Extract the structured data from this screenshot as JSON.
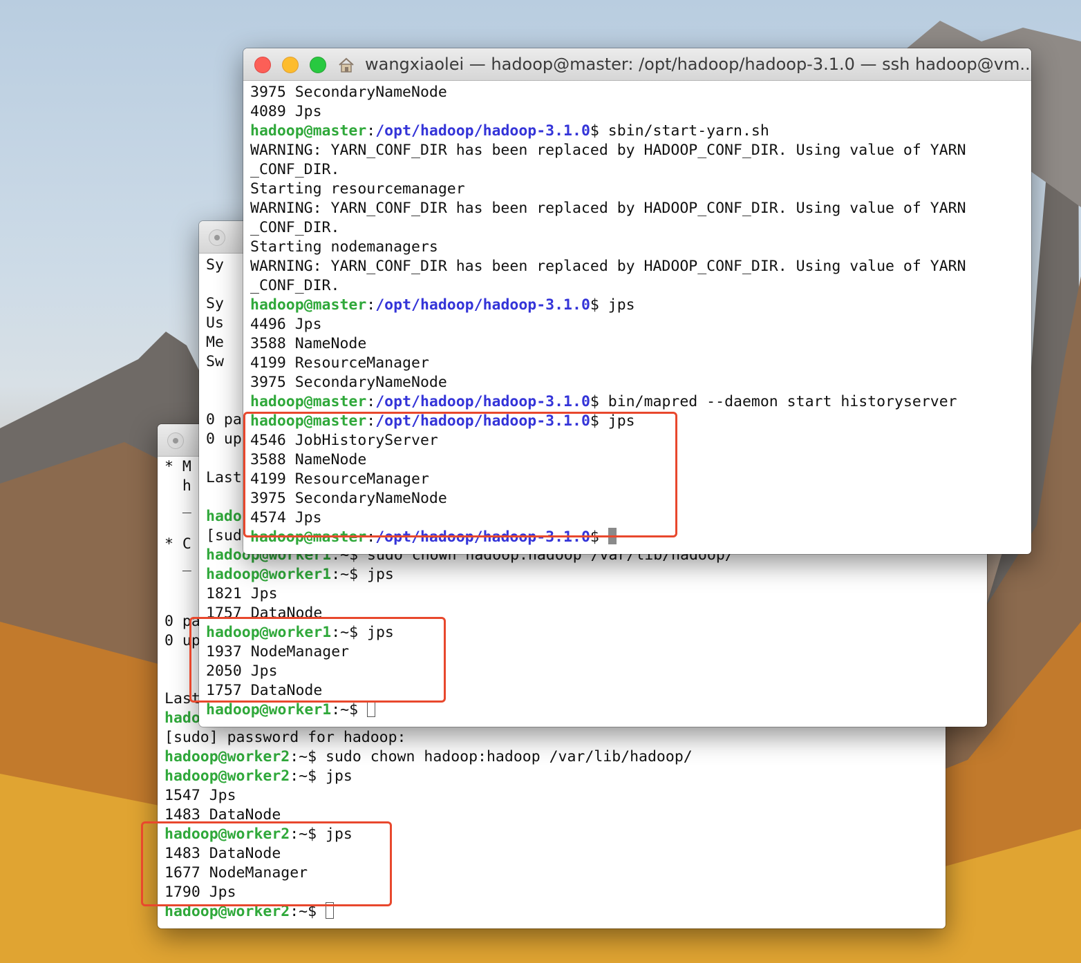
{
  "master": {
    "title": "wangxiaolei — hadoop@master: /opt/hadoop/hadoop-3.1.0 — ssh hadoop@vm...",
    "lines": [
      [
        {
          "t": "3975 SecondaryNameNode"
        }
      ],
      [
        {
          "t": "4089 Jps"
        }
      ],
      [
        {
          "t": "hadoop@master",
          "c": "u"
        },
        {
          "t": ":"
        },
        {
          "t": "/opt/hadoop/hadoop-3.1.0",
          "c": "p"
        },
        {
          "t": "$ sbin/start-yarn.sh"
        }
      ],
      [
        {
          "t": "WARNING: YARN_CONF_DIR has been replaced by HADOOP_CONF_DIR. Using value of YARN"
        }
      ],
      [
        {
          "t": "_CONF_DIR."
        }
      ],
      [
        {
          "t": "Starting resourcemanager"
        }
      ],
      [
        {
          "t": "WARNING: YARN_CONF_DIR has been replaced by HADOOP_CONF_DIR. Using value of YARN"
        }
      ],
      [
        {
          "t": "_CONF_DIR."
        }
      ],
      [
        {
          "t": "Starting nodemanagers"
        }
      ],
      [
        {
          "t": "WARNING: YARN_CONF_DIR has been replaced by HADOOP_CONF_DIR. Using value of YARN"
        }
      ],
      [
        {
          "t": "_CONF_DIR."
        }
      ],
      [
        {
          "t": "hadoop@master",
          "c": "u"
        },
        {
          "t": ":"
        },
        {
          "t": "/opt/hadoop/hadoop-3.1.0",
          "c": "p"
        },
        {
          "t": "$ jps"
        }
      ],
      [
        {
          "t": "4496 Jps"
        }
      ],
      [
        {
          "t": "3588 NameNode"
        }
      ],
      [
        {
          "t": "4199 ResourceManager"
        }
      ],
      [
        {
          "t": "3975 SecondaryNameNode"
        }
      ],
      [
        {
          "t": "hadoop@master",
          "c": "u"
        },
        {
          "t": ":"
        },
        {
          "t": "/opt/hadoop/hadoop-3.1.0",
          "c": "p"
        },
        {
          "t": "$ bin/mapred --daemon start historyserver"
        }
      ],
      [
        {
          "t": "hadoop@master",
          "c": "u"
        },
        {
          "t": ":"
        },
        {
          "t": "/opt/hadoop/hadoop-3.1.0",
          "c": "p"
        },
        {
          "t": "$ jps"
        }
      ],
      [
        {
          "t": "4546 JobHistoryServer"
        }
      ],
      [
        {
          "t": "3588 NameNode"
        }
      ],
      [
        {
          "t": "4199 ResourceManager"
        }
      ],
      [
        {
          "t": "3975 SecondaryNameNode"
        }
      ],
      [
        {
          "t": "4574 Jps"
        }
      ],
      [
        {
          "t": "hadoop@master",
          "c": "u"
        },
        {
          "t": ":"
        },
        {
          "t": "/opt/hadoop/hadoop-3.1.0",
          "c": "p"
        },
        {
          "t": "$ "
        },
        {
          "cursor": "block"
        }
      ]
    ],
    "bracket_rows": [
      2,
      11,
      16,
      17
    ]
  },
  "worker1": {
    "hidden_lines": [
      "Sy",
      "",
      "Sy",
      "Us",
      "Me",
      "Sw",
      "",
      "",
      "0 pa",
      "0 up",
      "",
      "Last"
    ],
    "lines": [
      [
        {
          "t": "hado",
          "c": "u"
        }
      ],
      [
        {
          "t": "[sud"
        }
      ],
      [
        {
          "t": "hadoop@worker1",
          "c": "u"
        },
        {
          "t": ":~$ sudo chown hadoop:hadoop /var/lib/hadoop/"
        }
      ],
      [
        {
          "t": "hadoop@worker1",
          "c": "u"
        },
        {
          "t": ":~$ jps"
        }
      ],
      [
        {
          "t": "1821 Jps"
        }
      ],
      [
        {
          "t": "1757 DataNode"
        }
      ],
      [
        {
          "t": "hadoop@worker1",
          "c": "u"
        },
        {
          "t": ":~$ jps"
        }
      ],
      [
        {
          "t": "1937 NodeManager"
        }
      ],
      [
        {
          "t": "2050 Jps"
        }
      ],
      [
        {
          "t": "1757 DataNode"
        }
      ],
      [
        {
          "t": "hadoop@worker1",
          "c": "u"
        },
        {
          "t": ":~$ "
        },
        {
          "cursor": "hollow"
        }
      ]
    ]
  },
  "worker2": {
    "hidden_lines": [
      "* M",
      "  h",
      "  _",
      "",
      "* C",
      "  _",
      "",
      "",
      "0 pa",
      "0 up",
      "",
      "",
      "Last"
    ],
    "lines": [
      [
        {
          "t": "hado",
          "c": "u"
        }
      ],
      [
        {
          "t": "[sudo] password for hadoop:"
        }
      ],
      [
        {
          "t": "hadoop@worker2",
          "c": "u"
        },
        {
          "t": ":~$ sudo chown hadoop:hadoop /var/lib/hadoop/"
        }
      ],
      [
        {
          "t": "hadoop@worker2",
          "c": "u"
        },
        {
          "t": ":~$ jps"
        }
      ],
      [
        {
          "t": "1547 Jps"
        }
      ],
      [
        {
          "t": "1483 DataNode"
        }
      ],
      [
        {
          "t": "hadoop@worker2",
          "c": "u"
        },
        {
          "t": ":~$ jps"
        }
      ],
      [
        {
          "t": "1483 DataNode"
        }
      ],
      [
        {
          "t": "1677 NodeManager"
        }
      ],
      [
        {
          "t": "1790 Jps"
        }
      ],
      [
        {
          "t": "hadoop@worker2",
          "c": "u"
        },
        {
          "t": ":~$ "
        },
        {
          "cursor": "hollow"
        }
      ]
    ]
  }
}
